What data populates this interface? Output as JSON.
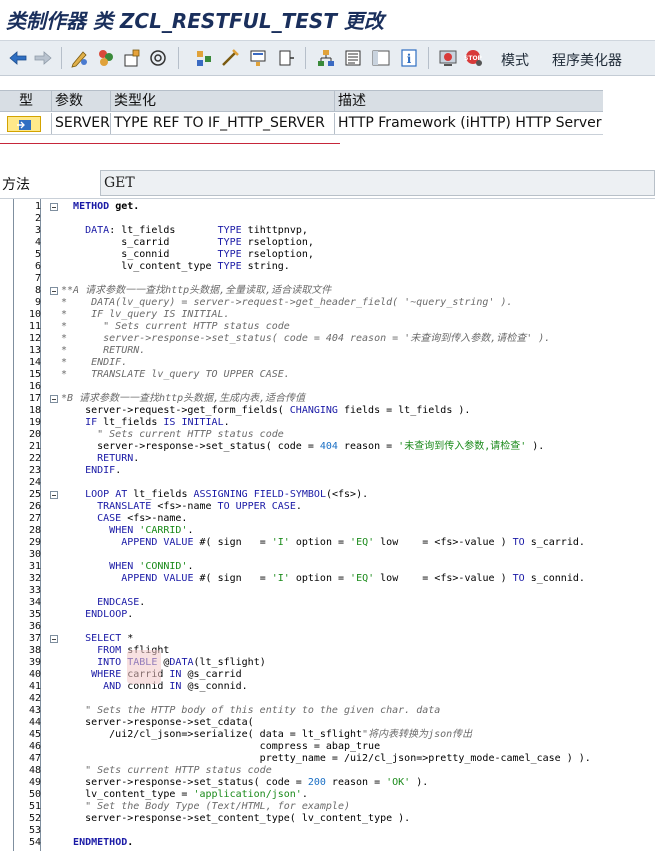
{
  "window": {
    "title": "类制作器 类 ZCL_RESTFUL_TEST 更改"
  },
  "toolbar": {
    "icons": [
      "back-icon",
      "forward-icon",
      "toggle-display-change-icon",
      "check-object-icon",
      "activate-icon",
      "where-used-icon",
      "object-list-icon",
      "navigate-icon",
      "display-object-list-icon",
      "find-icon",
      "hierarchy-icon",
      "print-icon",
      "info-icon",
      "help-icon",
      "stop-icon"
    ],
    "mode_label": "模式",
    "pretty_printer_label": "程序美化器"
  },
  "grid": {
    "headers": [
      "型",
      "参数",
      "类型化",
      "描述"
    ],
    "rows": [
      {
        "param": "SERVER",
        "typing": "TYPE REF TO IF_HTTP_SERVER",
        "description": "HTTP Framework (iHTTP) HTTP Server"
      }
    ]
  },
  "method": {
    "label": "方法",
    "value": "GET"
  },
  "code": {
    "lines": [
      {
        "n": "1",
        "t": "  METHOD get."
      },
      {
        "n": "2",
        "t": ""
      },
      {
        "n": "3",
        "t": "    DATA: lt_fields       TYPE tihttpnvp,"
      },
      {
        "n": "4",
        "t": "          s_carrid        TYPE rseloption,"
      },
      {
        "n": "5",
        "t": "          s_connid        TYPE rseloption,"
      },
      {
        "n": "6",
        "t": "          lv_content_type TYPE string."
      },
      {
        "n": "7",
        "t": ""
      },
      {
        "n": "8",
        "t": "**A 请求参数一一查找http头数据,全量读取,适合读取文件"
      },
      {
        "n": "9",
        "t": "*    DATA(lv_query) = server->request->get_header_field( '~query_string' )."
      },
      {
        "n": "10",
        "t": "*    IF lv_query IS INITIAL."
      },
      {
        "n": "11",
        "t": "*      \" Sets current HTTP status code"
      },
      {
        "n": "12",
        "t": "*      server->response->set_status( code = 404 reason = '未查询到传入参数,请检查' )."
      },
      {
        "n": "13",
        "t": "*      RETURN."
      },
      {
        "n": "14",
        "t": "*    ENDIF."
      },
      {
        "n": "15",
        "t": "*    TRANSLATE lv_query TO UPPER CASE."
      },
      {
        "n": "16",
        "t": ""
      },
      {
        "n": "17",
        "t": "*B 请求参数一一查找http头数据,生成内表,适合传值"
      },
      {
        "n": "18",
        "t": "    server->request->get_form_fields( CHANGING fields = lt_fields )."
      },
      {
        "n": "19",
        "t": "    IF lt_fields IS INITIAL."
      },
      {
        "n": "20",
        "t": "      \" Sets current HTTP status code"
      },
      {
        "n": "21",
        "t": "      server->response->set_status( code = 404 reason = '未查询到传入参数,请检查' )."
      },
      {
        "n": "22",
        "t": "      RETURN."
      },
      {
        "n": "23",
        "t": "    ENDIF."
      },
      {
        "n": "24",
        "t": ""
      },
      {
        "n": "25",
        "t": "    LOOP AT lt_fields ASSIGNING FIELD-SYMBOL(<fs>)."
      },
      {
        "n": "26",
        "t": "      TRANSLATE <fs>-name TO UPPER CASE."
      },
      {
        "n": "27",
        "t": "      CASE <fs>-name."
      },
      {
        "n": "28",
        "t": "        WHEN 'CARRID'."
      },
      {
        "n": "29",
        "t": "          APPEND VALUE #( sign   = 'I' option = 'EQ' low    = <fs>-value ) TO s_carrid."
      },
      {
        "n": "30",
        "t": ""
      },
      {
        "n": "31",
        "t": "        WHEN 'CONNID'."
      },
      {
        "n": "32",
        "t": "          APPEND VALUE #( sign   = 'I' option = 'EQ' low    = <fs>-value ) TO s_connid."
      },
      {
        "n": "33",
        "t": ""
      },
      {
        "n": "34",
        "t": "      ENDCASE."
      },
      {
        "n": "35",
        "t": "    ENDLOOP."
      },
      {
        "n": "36",
        "t": ""
      },
      {
        "n": "37",
        "t": "    SELECT *"
      },
      {
        "n": "38",
        "t": "      FROM sflight"
      },
      {
        "n": "39",
        "t": "      INTO TABLE @DATA(lt_sflight)"
      },
      {
        "n": "40",
        "t": "     WHERE carrid IN @s_carrid"
      },
      {
        "n": "41",
        "t": "       AND connid IN @s_connid."
      },
      {
        "n": "42",
        "t": ""
      },
      {
        "n": "43",
        "t": "    \" Sets the HTTP body of this entity to the given char. data"
      },
      {
        "n": "44",
        "t": "    server->response->set_cdata("
      },
      {
        "n": "45",
        "t": "        /ui2/cl_json=>serialize( data = lt_sflight\"将内表转换为json传出"
      },
      {
        "n": "46",
        "t": "                                 compress = abap_true"
      },
      {
        "n": "47",
        "t": "                                 pretty_name = /ui2/cl_json=>pretty_mode-camel_case ) )."
      },
      {
        "n": "48",
        "t": "    \" Sets current HTTP status code"
      },
      {
        "n": "49",
        "t": "    server->response->set_status( code = 200 reason = 'OK' )."
      },
      {
        "n": "50",
        "t": "    lv_content_type = 'application/json'."
      },
      {
        "n": "51",
        "t": "    \" Set the Body Type (Text/HTML, for example)"
      },
      {
        "n": "52",
        "t": "    server->response->set_content_type( lv_content_type )."
      },
      {
        "n": "53",
        "t": ""
      },
      {
        "n": "54",
        "t": "  ENDMETHOD."
      }
    ]
  }
}
